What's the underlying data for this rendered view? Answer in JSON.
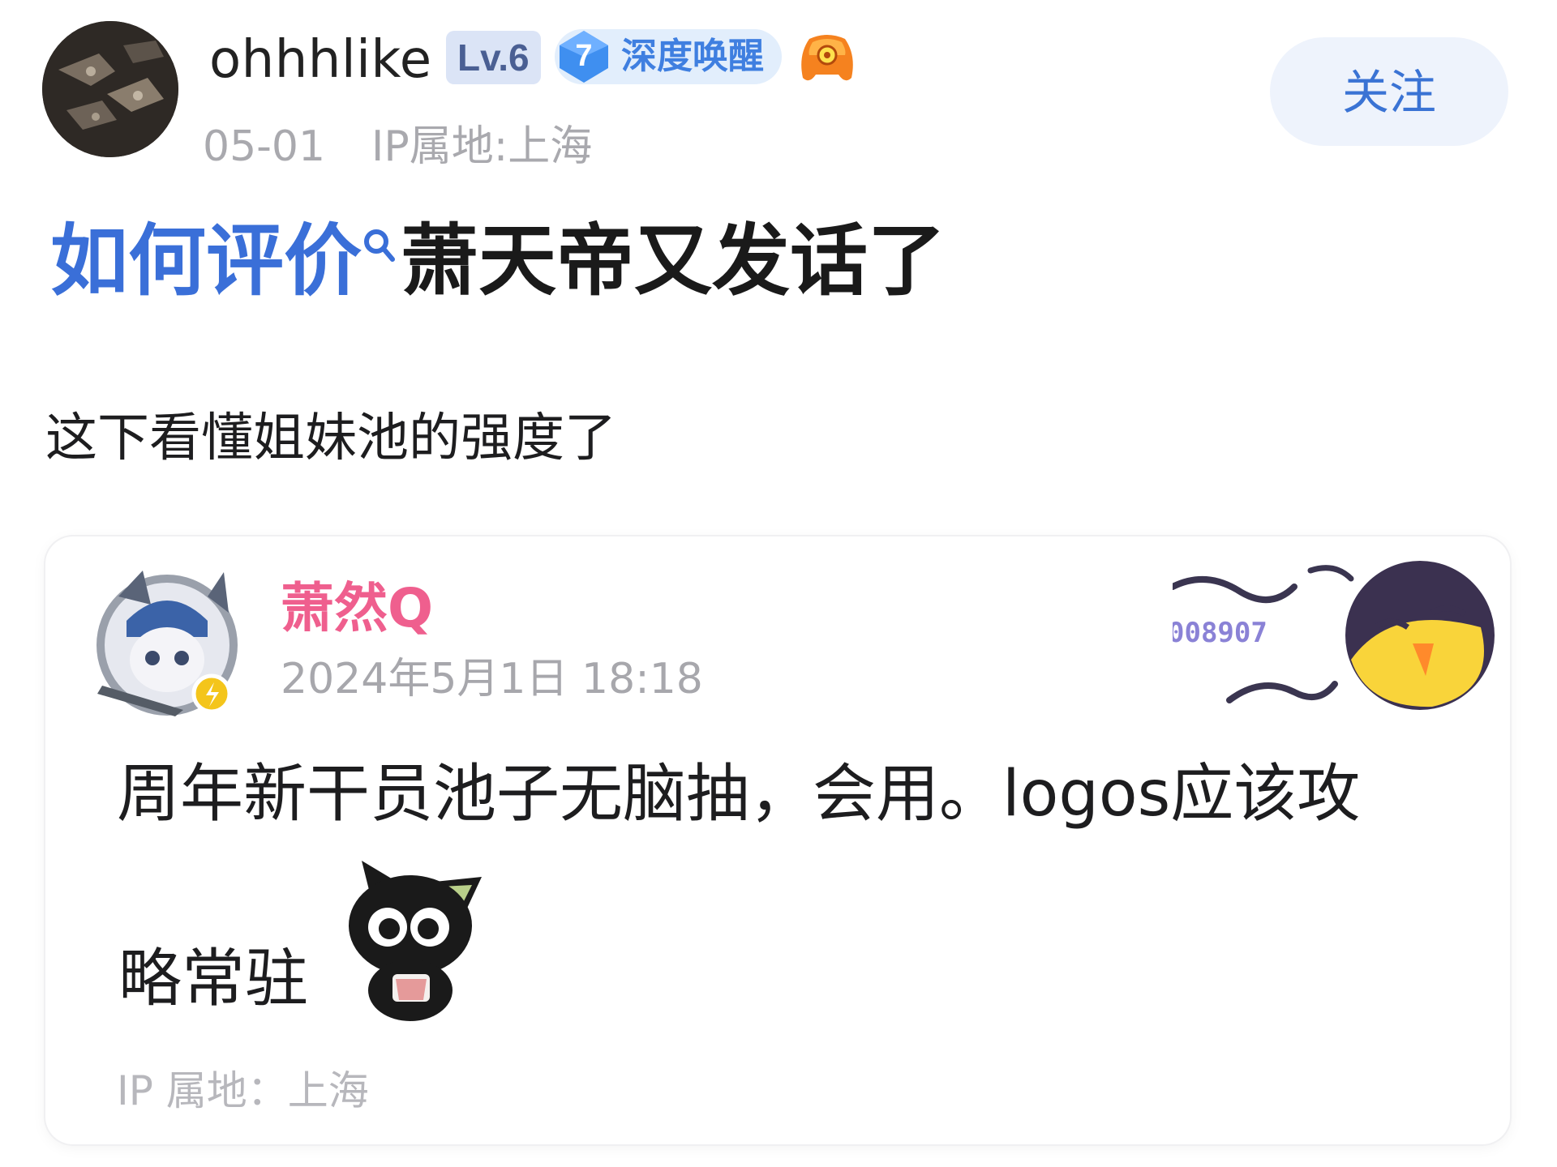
{
  "post": {
    "author": {
      "name": "ohhhlike",
      "level": "Lv.6",
      "honor_level": "7",
      "honor_title": "深度唤醒",
      "game_icon": "game-controller-icon"
    },
    "date": "05-01",
    "ip_location": "IP属地:上海",
    "follow_label": "关注",
    "title_link": "如何评价",
    "title_rest": "萧天帝又发话了",
    "body": "这下看懂姐妹池的强度了"
  },
  "quote": {
    "author_name": "萧然Q",
    "timestamp": "2024年5月1日 18:18",
    "decoration_code": "008907",
    "text_line1": "周年新干员池子无脑抽，会用。logos应该攻",
    "text_line2": "略常驻",
    "sticker": "black-cat-sticker",
    "ip_location": "IP 属地：上海"
  },
  "colors": {
    "link_blue": "#3a6fd8",
    "follow_text": "#3a73d4",
    "quote_name_pink": "#ef5f8e",
    "meta_gray": "#a9a9ae"
  }
}
